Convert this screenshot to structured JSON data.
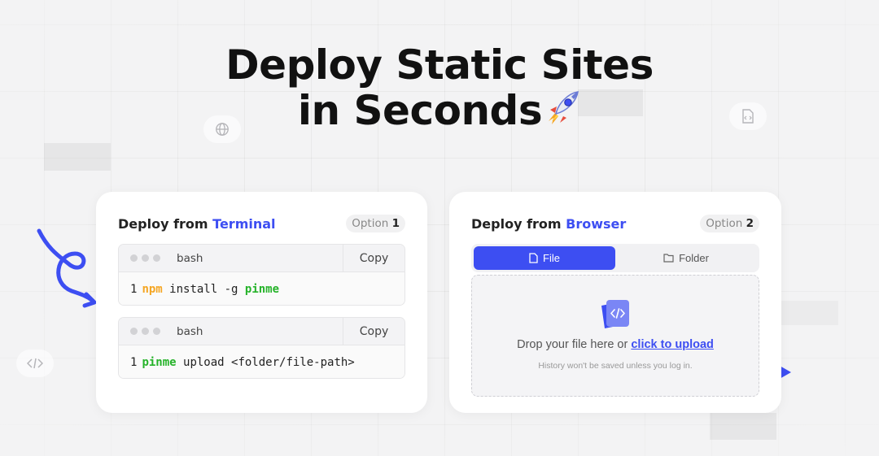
{
  "hero": {
    "title_line1": "Deploy Static Sites",
    "title_line2": "in Seconds"
  },
  "background_icons": [
    "globe-icon",
    "code-file-icon",
    "code-icon"
  ],
  "terminal_card": {
    "title_prefix": "Deploy from ",
    "title_accent": "Terminal",
    "option_label": "Option ",
    "option_number": "1",
    "blocks": [
      {
        "lang": "bash",
        "copy_label": "Copy",
        "line_number": "1",
        "command": "npm",
        "text": " install -g ",
        "arg": "pinme"
      },
      {
        "lang": "bash",
        "copy_label": "Copy",
        "line_number": "1",
        "command": "pinme",
        "text": " upload <folder/file-path>",
        "arg": ""
      }
    ]
  },
  "browser_card": {
    "title_prefix": "Deploy from ",
    "title_accent": "Browser",
    "option_label": "Option ",
    "option_number": "2",
    "tabs": [
      {
        "label": "File",
        "icon": "file-icon",
        "active": true
      },
      {
        "label": "Folder",
        "icon": "folder-icon",
        "active": false
      }
    ],
    "drop_text": "Drop your file here or ",
    "upload_link": "click to upload",
    "note": "History won't be saved unless you log in."
  },
  "colors": {
    "accent": "#3d4ef2",
    "keyword_orange": "#f5a623",
    "keyword_green": "#26b32a",
    "background": "#f3f3f4"
  }
}
